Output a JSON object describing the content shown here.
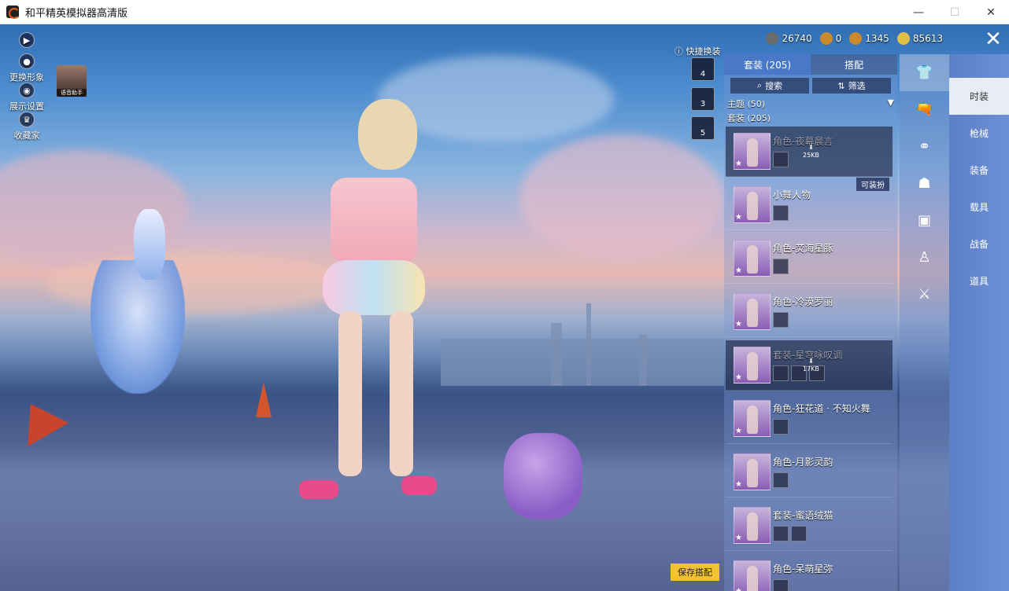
{
  "window": {
    "title": "和平精英模拟器高清版",
    "minimize": "—",
    "maximize": "☐",
    "close": "✕"
  },
  "sidebar": {
    "items": [
      {
        "label": "",
        "icon": "play-icon"
      },
      {
        "label": "更换形象",
        "icon": "avatar-icon"
      },
      {
        "label": "展示设置",
        "icon": "eye-icon"
      },
      {
        "label": "收藏家",
        "icon": "crown-icon"
      }
    ],
    "assistant_label": "语音助手"
  },
  "currency": [
    {
      "value": "26740",
      "color": "#6b6b6b"
    },
    {
      "value": "0",
      "color": "#c98a2c"
    },
    {
      "value": "1345",
      "color": "#c9892c"
    },
    {
      "value": "85613",
      "color": "#e0c048"
    }
  ],
  "quick_swap": {
    "label": "快捷换装",
    "slots": [
      "4",
      "3",
      "5"
    ]
  },
  "panel": {
    "tabs": [
      {
        "label": "套装 (205)",
        "active": true
      },
      {
        "label": "搭配",
        "active": false
      }
    ],
    "search_label": "搜索",
    "filter_label": "筛选",
    "categories": [
      {
        "label": "主题 (50)",
        "arrow": "▼"
      },
      {
        "label": "套装 (205)",
        "arrow": ""
      }
    ],
    "items": [
      {
        "name": "角色-夜幕晨言",
        "dim": true,
        "download": "25KB",
        "badge": "",
        "minis": 1
      },
      {
        "name": "小舞人物",
        "dim": false,
        "download": "",
        "badge": "可装扮",
        "minis": 1
      },
      {
        "name": "角色-荧海星豚",
        "dim": false,
        "download": "",
        "badge": "",
        "minis": 1
      },
      {
        "name": "角色-冷漠罗丽",
        "dim": false,
        "download": "",
        "badge": "",
        "minis": 1
      },
      {
        "name": "套装-星穹咏叹调",
        "dim": true,
        "download": "17KB",
        "badge": "",
        "minis": 3
      },
      {
        "name": "角色-狂花道 · 不知火舞",
        "dim": false,
        "download": "",
        "badge": "",
        "minis": 1
      },
      {
        "name": "角色-月影灵韵",
        "dim": false,
        "download": "",
        "badge": "",
        "minis": 1
      },
      {
        "name": "套装-蜜语绒猫",
        "dim": false,
        "download": "",
        "badge": "",
        "minis": 2
      },
      {
        "name": "角色-呆萌星弥",
        "dim": false,
        "download": "",
        "badge": "",
        "minis": 1
      }
    ]
  },
  "icon_column": [
    "outfit-icon",
    "gun-skin-icon",
    "goggles-icon",
    "mask-icon",
    "backpack-icon",
    "figure-icon",
    "rifle-icon"
  ],
  "nav": [
    {
      "label": "时装",
      "active": true
    },
    {
      "label": "枪械",
      "active": false
    },
    {
      "label": "装备",
      "active": false
    },
    {
      "label": "载具",
      "active": false
    },
    {
      "label": "战备",
      "active": false
    },
    {
      "label": "道具",
      "active": false
    }
  ],
  "save_button": "保存搭配",
  "close_panel": "✕"
}
